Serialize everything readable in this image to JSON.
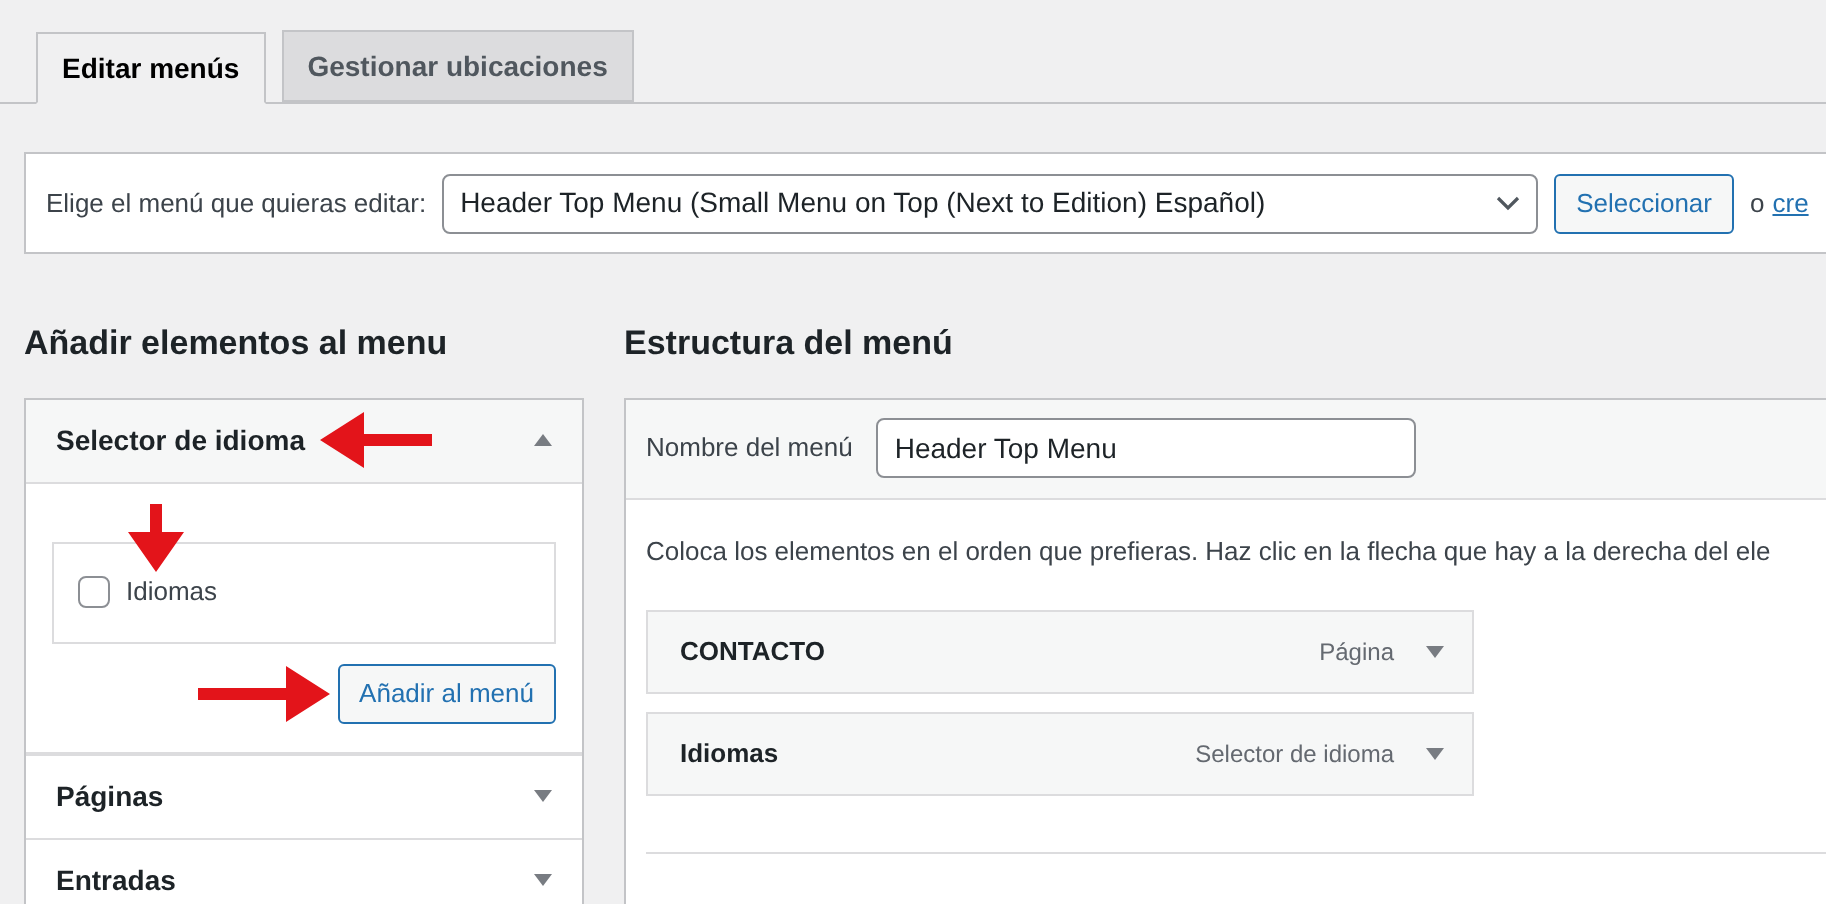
{
  "tabs": [
    {
      "label": "Editar menús",
      "selected": true
    },
    {
      "label": "Gestionar ubicaciones",
      "selected": false
    }
  ],
  "menu_select": {
    "label": "Elige el menú que quieras editar:",
    "value": "Header Top Menu (Small Menu on Top (Next to Edition) Español)",
    "button": "Seleccionar",
    "or_text": "o",
    "link": "cre"
  },
  "add_items": {
    "title": "Añadir elementos al menu",
    "sections": [
      {
        "title": "Selector de idioma",
        "expanded": true,
        "items": [
          {
            "label": "Idiomas",
            "checked": false
          }
        ],
        "button": "Añadir al menú"
      },
      {
        "title": "Páginas",
        "expanded": false
      },
      {
        "title": "Entradas",
        "expanded": false
      }
    ]
  },
  "structure": {
    "title": "Estructura del menú",
    "name_label": "Nombre del menú",
    "name_value": "Header Top Menu",
    "instructions": "Coloca los elementos en el orden que prefieras. Haz clic en la flecha que hay a la derecha del ele",
    "items": [
      {
        "title": "CONTACTO",
        "type": "Página"
      },
      {
        "title": "Idiomas",
        "type": "Selector de idioma"
      }
    ]
  }
}
